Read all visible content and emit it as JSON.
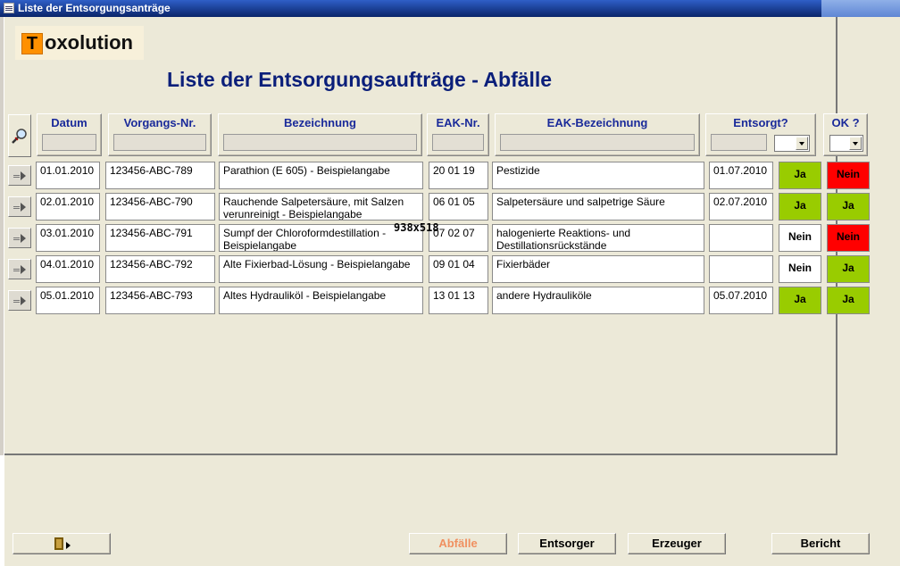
{
  "window": {
    "title": "Liste der Entsorgungsanträge"
  },
  "logo": {
    "letter": "T",
    "text": "oxolution"
  },
  "page_title": "Liste der Entsorgungsaufträge - Abfälle",
  "columns": {
    "datum": "Datum",
    "vorgang": "Vorgangs-Nr.",
    "bezeichnung": "Bezeichnung",
    "eak": "EAK-Nr.",
    "eak_bez": "EAK-Bezeichnung",
    "entsorgt": "Entsorgt?",
    "ok": "OK ?"
  },
  "icons": {
    "find": "find-magnifier-icon",
    "row": "record-selector-icon",
    "exit": "exit-door-icon"
  },
  "colors": {
    "yes": "#99cc00",
    "no": "#ff0000",
    "title": "#0b1f7a"
  },
  "rows": [
    {
      "datum": "01.01.2010",
      "vorgang": "123456-ABC-789",
      "bezeichnung": "Parathion (E 605) - Beispielangabe",
      "eak": "20 01 19",
      "eak_bez": "Pestizide",
      "entsorgt_datum": "01.07.2010",
      "entsorgt": "Ja",
      "ok": "Nein"
    },
    {
      "datum": "02.01.2010",
      "vorgang": "123456-ABC-790",
      "bezeichnung": "Rauchende Salpetersäure, mit Salzen verunreinigt - Beispielangabe",
      "eak": "06 01 05",
      "eak_bez": "Salpetersäure und salpetrige Säure",
      "entsorgt_datum": "02.07.2010",
      "entsorgt": "Ja",
      "ok": "Ja"
    },
    {
      "datum": "03.01.2010",
      "vorgang": "123456-ABC-791",
      "bezeichnung": "Sumpf der Chloroformdestillation - Beispielangabe",
      "eak": "07 02 07",
      "eak_bez": "halogenierte Reaktions- und Destillationsrückstände",
      "entsorgt_datum": "",
      "entsorgt": "Nein",
      "ok": "Nein"
    },
    {
      "datum": "04.01.2010",
      "vorgang": "123456-ABC-792",
      "bezeichnung": "Alte Fixierbad-Lösung - Beispielangabe",
      "eak": "09 01 04",
      "eak_bez": "Fixierbäder",
      "entsorgt_datum": "",
      "entsorgt": "Nein",
      "ok": "Ja"
    },
    {
      "datum": "05.01.2010",
      "vorgang": "123456-ABC-793",
      "bezeichnung": "Altes Hydrauliköl - Beispielangabe",
      "eak": "13 01 13",
      "eak_bez": "andere Hydrauliköle",
      "entsorgt_datum": "05.07.2010",
      "entsorgt": "Ja",
      "ok": "Ja"
    }
  ],
  "dimension_label": "938x518",
  "buttons": {
    "abfaelle": "Abfälle",
    "entsorger": "Entsorger",
    "erzeuger": "Erzeuger",
    "bericht": "Bericht"
  }
}
